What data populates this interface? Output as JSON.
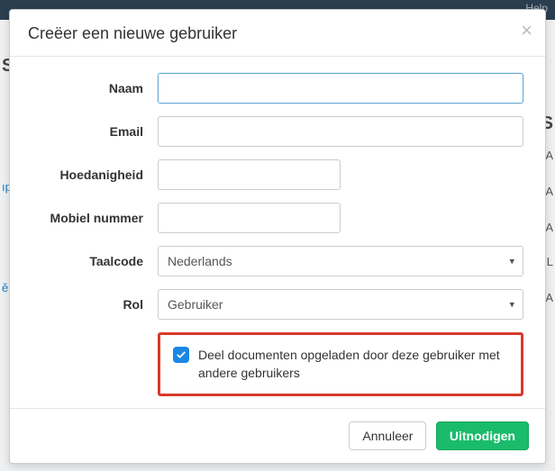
{
  "header": {
    "help_label": "Help"
  },
  "modal": {
    "title": "Creëer een nieuwe gebruiker",
    "close_glyph": "×",
    "cancel_label": "Annuleer",
    "submit_label": "Uitnodigen"
  },
  "form": {
    "name": {
      "label": "Naam",
      "value": ""
    },
    "email": {
      "label": "Email",
      "value": ""
    },
    "capacity": {
      "label": "Hoedanigheid",
      "value": ""
    },
    "mobile": {
      "label": "Mobiel nummer",
      "value": ""
    },
    "language": {
      "label": "Taalcode",
      "selected": "Nederlands"
    },
    "role": {
      "label": "Rol",
      "selected": "Gebruiker"
    },
    "share": {
      "checked": true,
      "label": "Deel documenten opgeladen door deze gebruiker met andere gebruikers"
    }
  }
}
